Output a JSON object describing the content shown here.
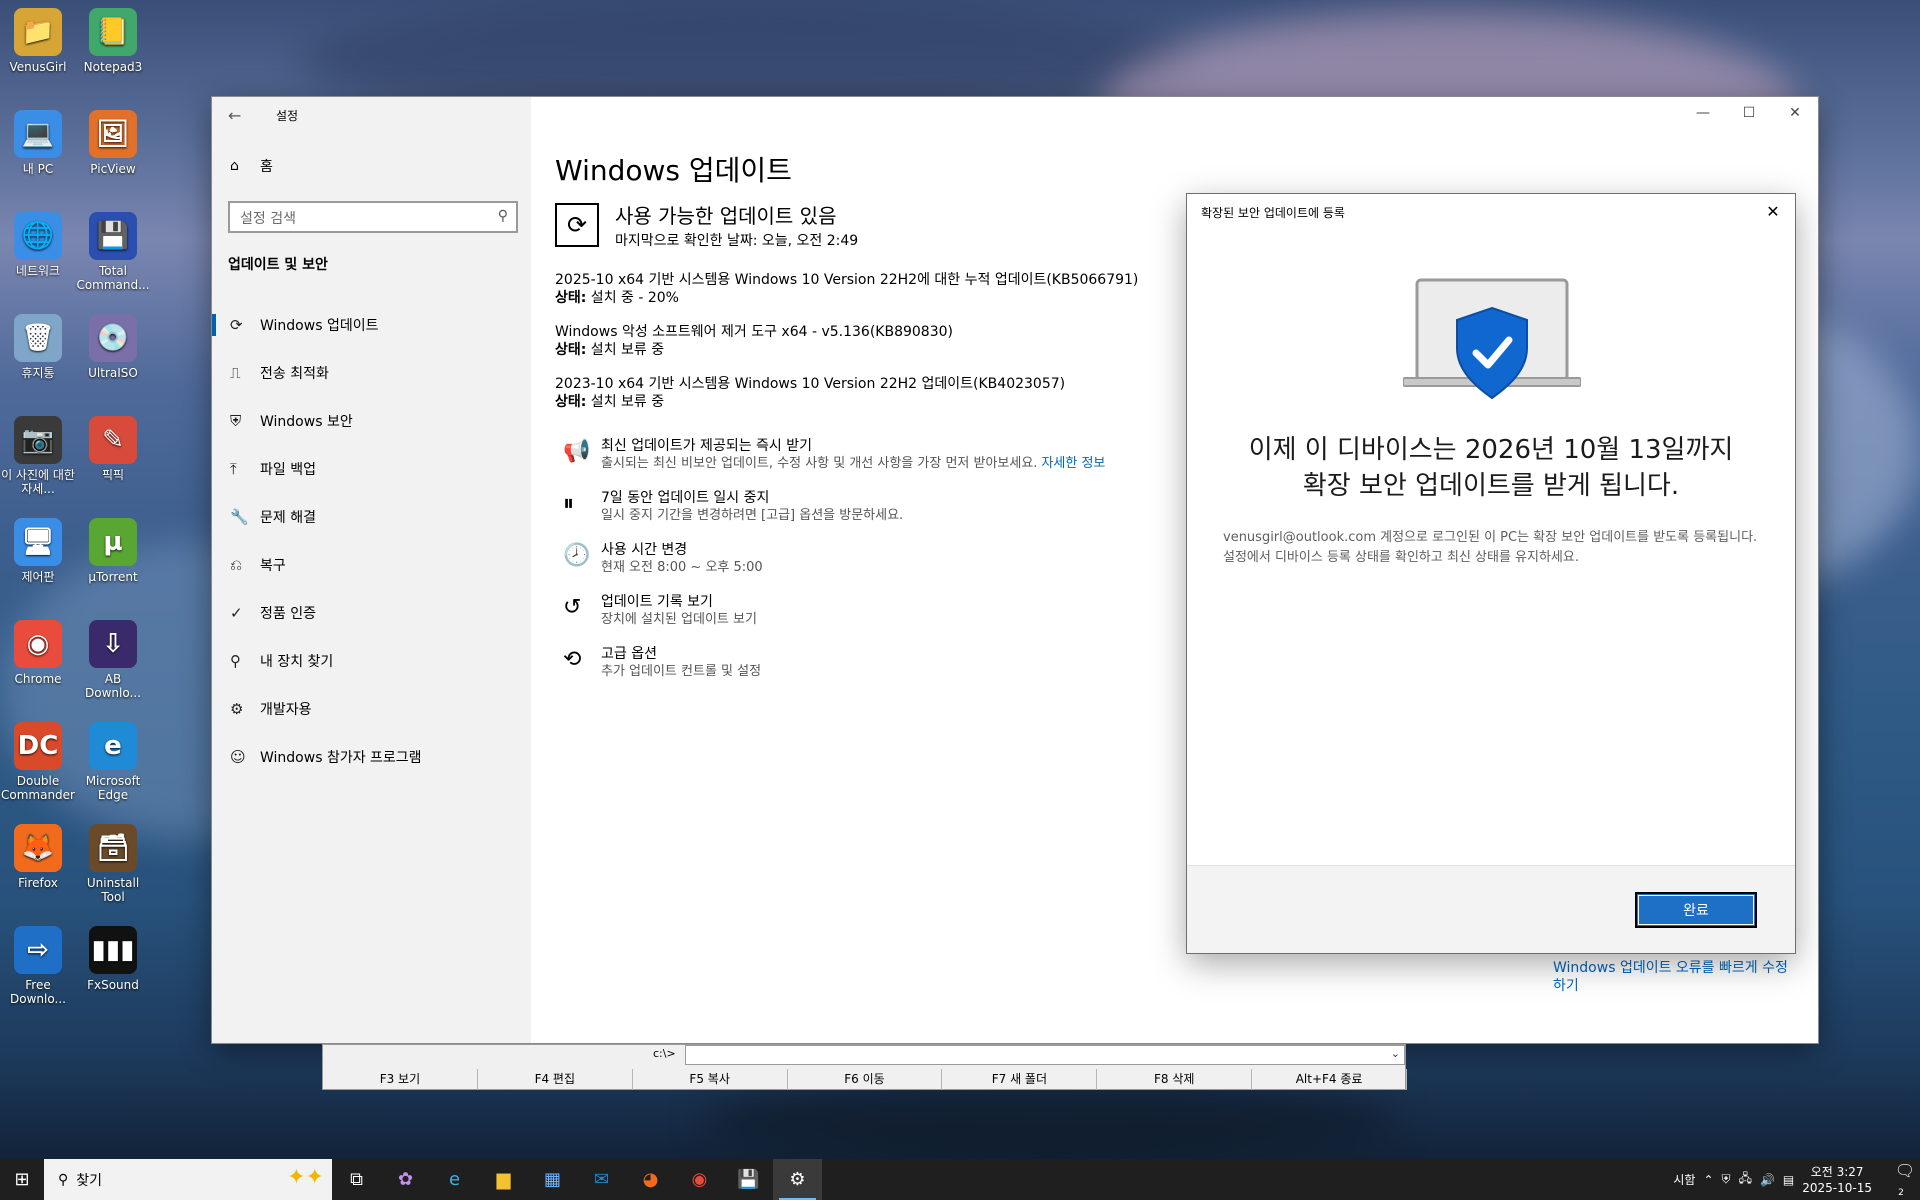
{
  "desktop": {
    "icons": [
      {
        "label": "VenusGirl",
        "color": "#d6a536",
        "glyph": "📁"
      },
      {
        "label": "Notepad3",
        "color": "#3fa86a",
        "glyph": "📒"
      },
      {
        "label": "내 PC",
        "color": "#3a8ee6",
        "glyph": "💻"
      },
      {
        "label": "PicView",
        "color": "#e0702a",
        "glyph": "🖼"
      },
      {
        "label": "네트워크",
        "color": "#3a8ee6",
        "glyph": "🌐"
      },
      {
        "label": "Total Command...",
        "color": "#2a4fb0",
        "glyph": "💾"
      },
      {
        "label": "휴지통",
        "color": "#7fa6c8",
        "glyph": "🗑"
      },
      {
        "label": "UltraISO",
        "color": "#7a6fa8",
        "glyph": "💿"
      },
      {
        "label": "이 사진에 대한 자세...",
        "color": "#3a3a3a",
        "glyph": "📷"
      },
      {
        "label": "픽픽",
        "color": "#d84a3a",
        "glyph": "✎"
      },
      {
        "label": "제어판",
        "color": "#3a8ee6",
        "glyph": "🖥"
      },
      {
        "label": "µTorrent",
        "color": "#59a632",
        "glyph": "µ"
      },
      {
        "label": "Chrome",
        "color": "#e94b3c",
        "glyph": "◉"
      },
      {
        "label": "AB Downlo...",
        "color": "#3b2a6b",
        "glyph": "⇩"
      },
      {
        "label": "Double Commander",
        "color": "#d94a2a",
        "glyph": "DC"
      },
      {
        "label": "Microsoft Edge",
        "color": "#1f8ad6",
        "glyph": "e"
      },
      {
        "label": "Firefox",
        "color": "#f26b1d",
        "glyph": "🦊"
      },
      {
        "label": "Uninstall Tool",
        "color": "#6b4a2a",
        "glyph": "🗃"
      },
      {
        "label": "Free Downlo...",
        "color": "#1f6fc6",
        "glyph": "⇨"
      },
      {
        "label": "FxSound",
        "color": "#111111",
        "glyph": "▮▮▮"
      }
    ]
  },
  "window": {
    "title": "설정",
    "sidebar": {
      "home": "홈",
      "search_placeholder": "설정 검색",
      "section": "업데이트 및 보안",
      "items": [
        {
          "label": "Windows 업데이트",
          "icon": "sync-icon",
          "glyph": "⟳",
          "active": true
        },
        {
          "label": "전송 최적화",
          "icon": "delivery-icon",
          "glyph": "⎍",
          "active": false
        },
        {
          "label": "Windows 보안",
          "icon": "shield-icon",
          "glyph": "⛨",
          "active": false
        },
        {
          "label": "파일 백업",
          "icon": "backup-icon",
          "glyph": "⤒",
          "active": false
        },
        {
          "label": "문제 해결",
          "icon": "wrench-icon",
          "glyph": "🔧",
          "active": false
        },
        {
          "label": "복구",
          "icon": "recovery-icon",
          "glyph": "⎌",
          "active": false
        },
        {
          "label": "정품 인증",
          "icon": "check-circle-icon",
          "glyph": "✓",
          "active": false
        },
        {
          "label": "내 장치 찾기",
          "icon": "find-device-icon",
          "glyph": "⚲",
          "active": false
        },
        {
          "label": "개발자용",
          "icon": "developer-icon",
          "glyph": "⚙",
          "active": false
        },
        {
          "label": "Windows 참가자 프로그램",
          "icon": "insider-icon",
          "glyph": "☺",
          "active": false
        }
      ]
    },
    "main": {
      "title": "Windows 업데이트",
      "status_title": "사용 가능한 업데이트 있음",
      "status_sub": "마지막으로 확인한 날짜: 오늘, 오전 2:49",
      "updates": [
        {
          "name": "2025-10 x64 기반 시스템용 Windows 10 Version 22H2에 대한 누적 업데이트(KB5066791)",
          "status_label": "상태:",
          "status": " 설치 중 - 20%"
        },
        {
          "name": "Windows 악성 소프트웨어 제거 도구 x64 - v5.136(KB890830)",
          "status_label": "상태:",
          "status": " 설치 보류 중"
        },
        {
          "name": "2023-10 x64 기반 시스템용 Windows 10 Version 22H2 업데이트(KB4023057)",
          "status_label": "상태:",
          "status": " 설치 보류 중"
        }
      ],
      "options": [
        {
          "title": "최신 업데이트가 제공되는 즉시 받기",
          "sub": "출시되는 최신 비보안 업데이트, 수정 사항 및 개선 사항을 가장 먼저 받아보세요.",
          "link": "자세한 정보",
          "icon": "megaphone-icon",
          "glyph": "📢"
        },
        {
          "title": "7일 동안 업데이트 일시 중지",
          "sub": "일시 중지 기간을 변경하려면 [고급] 옵션을 방문하세요.",
          "link": "",
          "icon": "pause-icon",
          "glyph": "⏸"
        },
        {
          "title": "사용 시간 변경",
          "sub": "현재 오전 8:00 ~ 오후 5:00",
          "link": "",
          "icon": "clock-icon",
          "glyph": "🕗"
        },
        {
          "title": "업데이트 기록 보기",
          "sub": "장치에 설치된 업데이트 보기",
          "link": "",
          "icon": "history-icon",
          "glyph": "↺"
        },
        {
          "title": "고급 옵션",
          "sub": "추가 업데이트 컨트롤 및 설정",
          "link": "",
          "icon": "advanced-sync-icon",
          "glyph": "⟲"
        }
      ],
      "right_link": "Windows 업데이트 오류를 빠르게 수정하기"
    }
  },
  "dialog": {
    "title": "확장된 보안 업데이트에 등록",
    "headline_1": "이제 이 디바이스는 2026년 10월 13일까지",
    "headline_2": "확장 보안 업데이트를 받게 됩니다.",
    "body": "venusgirl@outlook.com 계정으로 로그인된 이 PC는 확장 보안 업데이트를 받도록 등록됩니다. 설정에서 디바이스 등록 상태를 확인하고 최신 상태를 유지하세요.",
    "done": "완료"
  },
  "total_commander": {
    "path": "c:\\>",
    "keys": [
      "F3 보기",
      "F4 편집",
      "F5 복사",
      "F6 이동",
      "F7 새 폴더",
      "F8 삭제",
      "Alt+F4 종료"
    ]
  },
  "taskbar": {
    "search": "찾기",
    "language": "시함",
    "time": "오전 3:27",
    "date": "2025-10-15",
    "notifications": "2"
  }
}
